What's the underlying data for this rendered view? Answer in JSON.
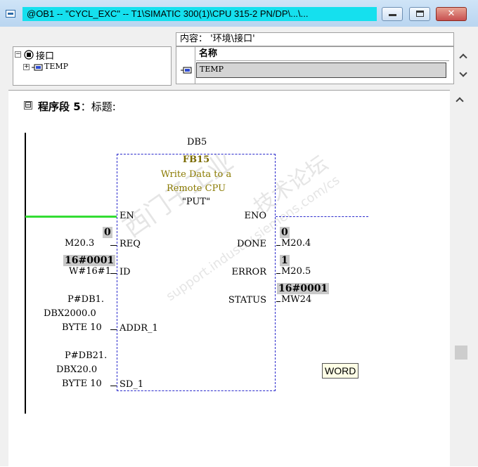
{
  "window": {
    "title": "@OB1 -- \"CYCL_EXC\" -- T1\\SIMATIC 300(1)\\CPU 315-2 PN/DP\\...\\...",
    "close_glyph": "✕"
  },
  "interface": {
    "content_header": "内容： '环境\\接口'",
    "tree_root": "接口",
    "tree_child": "TEMP",
    "column_name": "名称",
    "row_value": "TEMP"
  },
  "network": {
    "collapse_glyph": "⊟",
    "label": "程序段 5",
    "separator": "：",
    "title_label": "标题:",
    "db_name": "DB5",
    "fb_name": "FB15",
    "fb_comment_line1": "Write Data to a",
    "fb_comment_line2": "Remote CPU",
    "fb_symbol": "\"PUT\"",
    "pins": {
      "en": "EN",
      "eno": "ENO",
      "req": "REQ",
      "id": "ID",
      "addr": "ADDR_1",
      "sd": "SD_1",
      "done": "DONE",
      "error": "ERROR",
      "status": "STATUS"
    },
    "inputs": {
      "req_value": "0",
      "req_operand": "M20.3",
      "id_value": "16#0001",
      "id_operand": "W#16#1",
      "addr_line1": "P#DB1.",
      "addr_line2": "DBX2000.0",
      "addr_line3": "BYTE 10",
      "sd_line1": "P#DB21.",
      "sd_line2": "DBX20.0",
      "sd_line3": "BYTE 10"
    },
    "outputs": {
      "done_value": "0",
      "done_operand": "M20.4",
      "error_value": "1",
      "error_operand": "M20.5",
      "status_value": "16#0001",
      "status_operand": "MW24"
    },
    "tooltip": "WORD"
  },
  "watermark": {
    "main": "西门子工业",
    "sub": "support.industry.siemens.com/cs",
    "forum": "技术论坛"
  },
  "colors": {
    "title_highlight": "#15e0ee",
    "power_flow": "#33dd33",
    "box_border": "#2a2acc",
    "value_bg": "#c8c8c8",
    "fb_text": "#7a6a00"
  }
}
